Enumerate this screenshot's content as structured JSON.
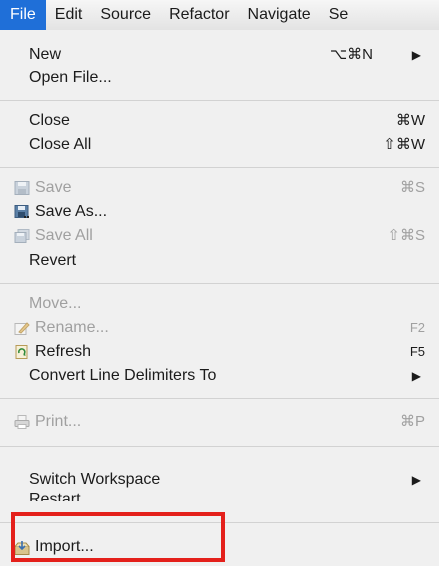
{
  "menubar": {
    "items": [
      {
        "label": "File",
        "active": true
      },
      {
        "label": "Edit"
      },
      {
        "label": "Source"
      },
      {
        "label": "Refactor"
      },
      {
        "label": "Navigate"
      },
      {
        "label": "Se"
      }
    ]
  },
  "menu": {
    "new": {
      "label": "New",
      "shortcut": "⌥⌘N",
      "submenu": "▶"
    },
    "open_file": {
      "label": "Open File..."
    },
    "close": {
      "label": "Close",
      "shortcut": "⌘W"
    },
    "close_all": {
      "label": "Close All",
      "shortcut": "⇧⌘W"
    },
    "save": {
      "label": "Save",
      "shortcut": "⌘S",
      "icon": "save-icon"
    },
    "save_as": {
      "label": "Save As...",
      "icon": "save-as-icon"
    },
    "save_all": {
      "label": "Save All",
      "shortcut": "⇧⌘S",
      "icon": "save-all-icon"
    },
    "revert": {
      "label": "Revert"
    },
    "move": {
      "label": "Move..."
    },
    "rename": {
      "label": "Rename...",
      "shortcut": "F2",
      "icon": "rename-icon"
    },
    "refresh": {
      "label": "Refresh",
      "shortcut": "F5",
      "icon": "refresh-icon"
    },
    "convert_line_delimiters": {
      "label": "Convert Line Delimiters To",
      "submenu": "▶"
    },
    "print": {
      "label": "Print...",
      "shortcut": "⌘P",
      "icon": "print-icon"
    },
    "switch_workspace": {
      "label": "Switch Workspace",
      "submenu": "▶"
    },
    "restart": {
      "label": "Restart"
    },
    "import": {
      "label": "Import...",
      "icon": "import-icon"
    }
  },
  "colors": {
    "accent": "#1f6fd8",
    "highlight": "#e4201b",
    "disabled": "#a0a0a0"
  }
}
